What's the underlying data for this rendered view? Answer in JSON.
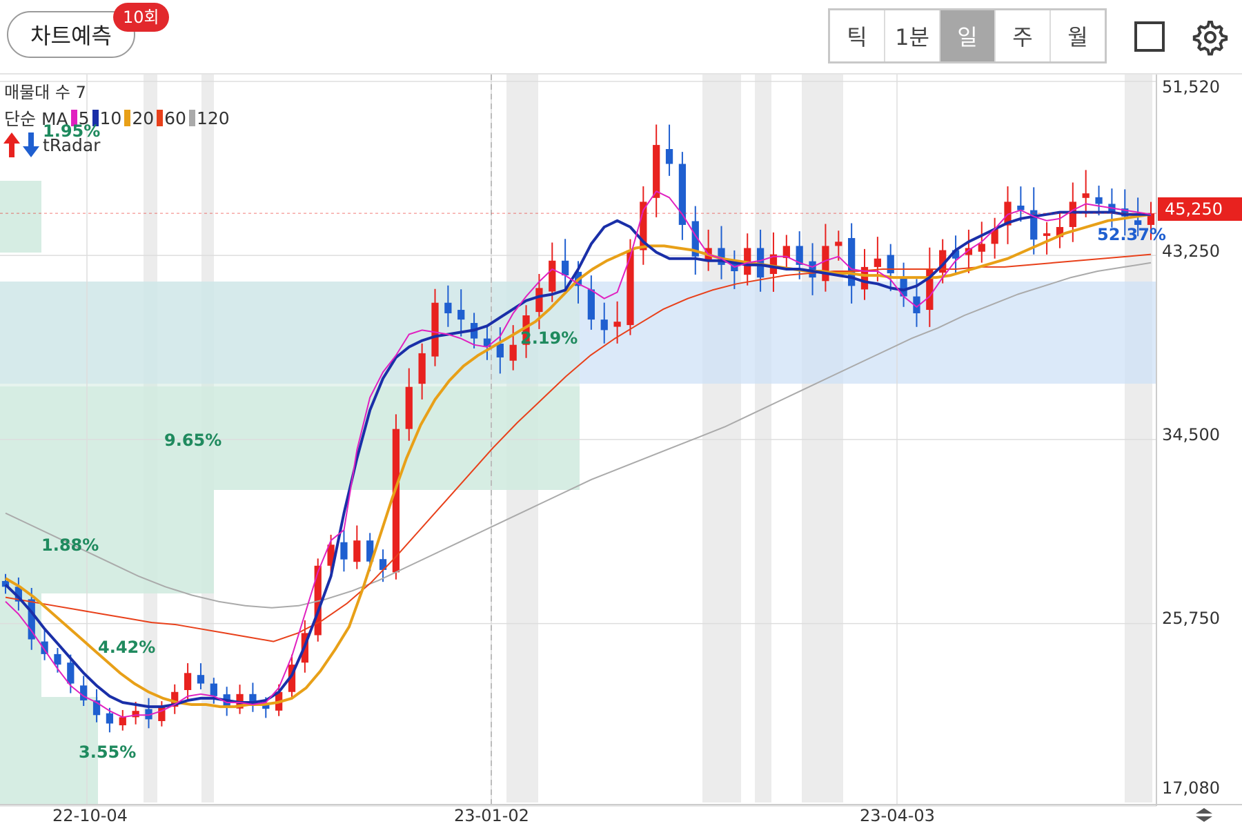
{
  "header": {
    "predict_label": "차트예측",
    "predict_badge": "10회",
    "periods": [
      "틱",
      "1분",
      "일",
      "주",
      "월"
    ],
    "active_period": "일"
  },
  "overlay": {
    "volume_profile_label": "매물대 수 7",
    "ma_prefix": "단순 MA",
    "ma": [
      {
        "label": "5",
        "color": "#e020c0"
      },
      {
        "label": "10",
        "color": "#1a2fa8"
      },
      {
        "label": "20",
        "color": "#e8a018"
      },
      {
        "label": "60",
        "color": "#e8401a"
      },
      {
        "label": "120",
        "color": "#aaaaaa"
      }
    ],
    "radar_label": "tRadar"
  },
  "colors": {
    "up": "#e8221f",
    "down": "#1f5fd0",
    "zone_green": "#d2ebe0",
    "zone_blue": "#cfe2f7"
  },
  "chart_data": {
    "type": "candlestick",
    "yticks": [
      "51,520",
      "43,250",
      "34,500",
      "25,750",
      "17,080"
    ],
    "ytick_values": [
      51520,
      43250,
      34500,
      25750,
      17080
    ],
    "ylim": [
      17080,
      51520
    ],
    "xticks": [
      "22-10-04",
      "23-01-02",
      "23-04-03"
    ],
    "current_price": "45,250",
    "volume_profile_pct": [
      "1.95%",
      "1.88%",
      "4.42%",
      "3.55%",
      "9.65%",
      "2.19%",
      "52.37%"
    ],
    "series_close": [
      27500,
      26800,
      25000,
      24300,
      23800,
      22900,
      22100,
      21400,
      21000,
      21300,
      21600,
      21200,
      21800,
      22500,
      23400,
      22900,
      22300,
      21800,
      22400,
      21900,
      21700,
      22500,
      23800,
      25300,
      28500,
      29500,
      28800,
      29700,
      28700,
      28300,
      35000,
      37000,
      38600,
      41000,
      40500,
      40200,
      39300,
      38900,
      38400,
      39000,
      40400,
      41700,
      43000,
      42300,
      41800,
      40200,
      39700,
      40100,
      43500,
      45800,
      48500,
      47600,
      44700,
      43200,
      43600,
      42800,
      42500,
      43600,
      42200,
      43300,
      43700,
      42800,
      42200,
      43700,
      43900,
      41800,
      42700,
      43100,
      42400,
      41300,
      40500,
      42600,
      43500,
      43100,
      43600,
      43800,
      44500,
      45800,
      45400,
      44000,
      44300,
      44600,
      45800,
      46200,
      45700,
      45300,
      45100,
      44700,
      45250
    ],
    "ma5": [
      26800,
      26200,
      25400,
      24500,
      23600,
      22800,
      22300,
      22000,
      21600,
      21300,
      21400,
      21400,
      21600,
      21900,
      22300,
      22400,
      22300,
      22000,
      22000,
      21900,
      22000,
      22700,
      24200,
      26200,
      28200,
      29700,
      30200,
      34000,
      36500,
      37700,
      38500,
      39500,
      39700,
      39600,
      39500,
      39300,
      39000,
      38900,
      39400,
      40500,
      41300,
      42000,
      42600,
      42300,
      41900,
      41600,
      41200,
      41500,
      43200,
      45400,
      46300,
      46000,
      45200,
      44200,
      43300,
      43100,
      42700,
      42900,
      43000,
      43200,
      43200,
      42900,
      42700,
      43000,
      43200,
      42600,
      42500,
      42500,
      42100,
      41300,
      40800,
      41300,
      42200,
      43000,
      43500,
      43900,
      44500,
      45200,
      45400,
      45100,
      44900,
      45000,
      45400,
      45700,
      45600,
      45500,
      45400,
      45300,
      45200
    ],
    "ma10": [
      27600,
      27000,
      26300,
      25500,
      24800,
      24100,
      23400,
      22800,
      22300,
      22000,
      21900,
      21800,
      21800,
      21900,
      22100,
      22200,
      22200,
      22100,
      22000,
      22000,
      22100,
      22500,
      23300,
      24700,
      26300,
      28000,
      31000,
      33600,
      35900,
      37400,
      38400,
      38900,
      39200,
      39400,
      39500,
      39600,
      39700,
      39900,
      40300,
      40700,
      41100,
      41300,
      41400,
      41600,
      42600,
      43800,
      44600,
      44900,
      44600,
      43900,
      43400,
      43100,
      43100,
      43100,
      43000,
      43000,
      42900,
      42800,
      42800,
      42700,
      42600,
      42600,
      42500,
      42400,
      42300,
      42200,
      42000,
      41900,
      41700,
      41600,
      41800,
      42200,
      42800,
      43500,
      43900,
      44200,
      44500,
      44800,
      45000,
      45100,
      45200,
      45300,
      45300,
      45300,
      45300,
      45300,
      45200,
      45200,
      45200
    ],
    "ma20": [
      27900,
      27500,
      27000,
      26400,
      25800,
      25200,
      24600,
      24000,
      23400,
      22900,
      22500,
      22200,
      22000,
      21900,
      21900,
      21800,
      21800,
      21900,
      21900,
      22000,
      22200,
      22700,
      23500,
      24500,
      25600,
      27500,
      29600,
      31700,
      33600,
      35200,
      36400,
      37300,
      38000,
      38500,
      38900,
      39300,
      39700,
      40100,
      40700,
      41400,
      42100,
      42600,
      43000,
      43300,
      43600,
      43700,
      43700,
      43600,
      43500,
      43300,
      43100,
      43000,
      42900,
      42800,
      42700,
      42600,
      42500,
      42500,
      42400,
      42400,
      42300,
      42300,
      42200,
      42200,
      42200,
      42200,
      42300,
      42500,
      42700,
      42900,
      43100,
      43400,
      43700,
      44000,
      44300,
      44500,
      44700,
      44900,
      45000,
      45100,
      45200
    ],
    "ma60": [
      27000,
      26800,
      26600,
      26400,
      26200,
      26000,
      25800,
      25700,
      25500,
      25300,
      25100,
      24900,
      25300,
      25900,
      26700,
      27700,
      28900,
      30200,
      31500,
      32800,
      34100,
      35300,
      36400,
      37500,
      38500,
      39300,
      40000,
      40700,
      41200,
      41600,
      41900,
      42100,
      42300,
      42400,
      42500,
      42500,
      42600,
      42600,
      42600,
      42600,
      42700,
      42700,
      42800,
      42900,
      43000,
      43100,
      43200,
      43300
    ],
    "ma120": [
      31000,
      30400,
      29800,
      29200,
      28600,
      28000,
      27500,
      27100,
      26800,
      26600,
      26500,
      26600,
      26900,
      27300,
      27800,
      28400,
      29000,
      29600,
      30200,
      30800,
      31400,
      32000,
      32600,
      33100,
      33600,
      34100,
      34600,
      35100,
      35700,
      36300,
      36900,
      37500,
      38100,
      38700,
      39300,
      39800,
      40400,
      40900,
      41400,
      41800,
      42200,
      42500,
      42700,
      42900
    ]
  }
}
